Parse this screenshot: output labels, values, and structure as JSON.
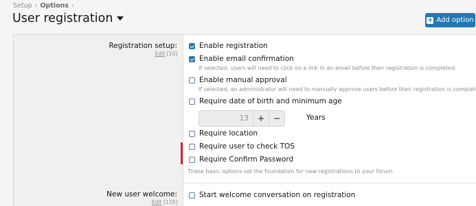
{
  "breadcrumb": {
    "items": [
      "Setup",
      "Options"
    ],
    "separator": "›"
  },
  "page": {
    "title": "User registration"
  },
  "header": {
    "add_option_label": "Add option"
  },
  "sections": {
    "registration_setup": {
      "label": "Registration setup:",
      "edit_label": "Edit",
      "display_order": "[10]",
      "options": [
        {
          "label": "Enable registration",
          "checked": true
        },
        {
          "label": "Enable email confirmation",
          "checked": true,
          "hint": "If selected, users will need to click on a link in an email before their registration is completed."
        },
        {
          "label": "Enable manual approval",
          "checked": false,
          "hint": "If selected, an administrator will need to manually approve users before their registration is completed"
        },
        {
          "label": "Require date of birth and minimum age",
          "checked": false
        },
        {
          "label": "Require location",
          "checked": false
        },
        {
          "label": "Require user to check TOS",
          "checked": false
        },
        {
          "label": "Require Confirm Password",
          "checked": false
        }
      ],
      "min_age": {
        "value": "13",
        "unit": "Years",
        "increment": "+",
        "decrement": "−"
      },
      "explain": "These basic options set the foundation for new registrations to your forum."
    },
    "new_user_welcome": {
      "label": "New user welcome:",
      "edit_label": "Edit",
      "display_order": "[110]",
      "options": [
        {
          "label": "Start welcome conversation on registration",
          "checked": false
        }
      ]
    }
  },
  "colors": {
    "accent": "#2577b1",
    "marker": "#d2232a"
  }
}
